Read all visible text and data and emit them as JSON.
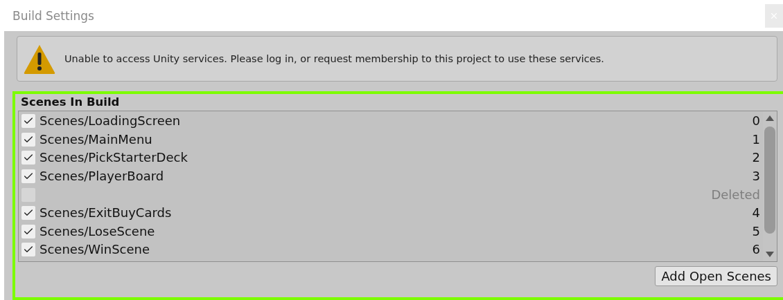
{
  "window": {
    "title": "Build Settings"
  },
  "warning": {
    "message": "Unable to access Unity services. Please log in, or request membership to this project to use these services."
  },
  "scenes_in_build": {
    "title": "Scenes In Build",
    "rows": [
      {
        "kind": "scene",
        "name": "Scenes/LoadingScreen",
        "index": "0",
        "checked": true
      },
      {
        "kind": "scene",
        "name": "Scenes/MainMenu",
        "index": "1",
        "checked": true
      },
      {
        "kind": "scene",
        "name": "Scenes/PickStarterDeck",
        "index": "2",
        "checked": true
      },
      {
        "kind": "scene",
        "name": "Scenes/PlayerBoard",
        "index": "3",
        "checked": true
      },
      {
        "kind": "deleted",
        "index": "Deleted",
        "checked": false
      },
      {
        "kind": "scene",
        "name": "Scenes/ExitBuyCards",
        "index": "4",
        "checked": true
      },
      {
        "kind": "scene",
        "name": "Scenes/LoseScene",
        "index": "5",
        "checked": true
      },
      {
        "kind": "scene",
        "name": "Scenes/WinScene",
        "index": "6",
        "checked": true
      }
    ],
    "button": "Add Open Scenes"
  }
}
